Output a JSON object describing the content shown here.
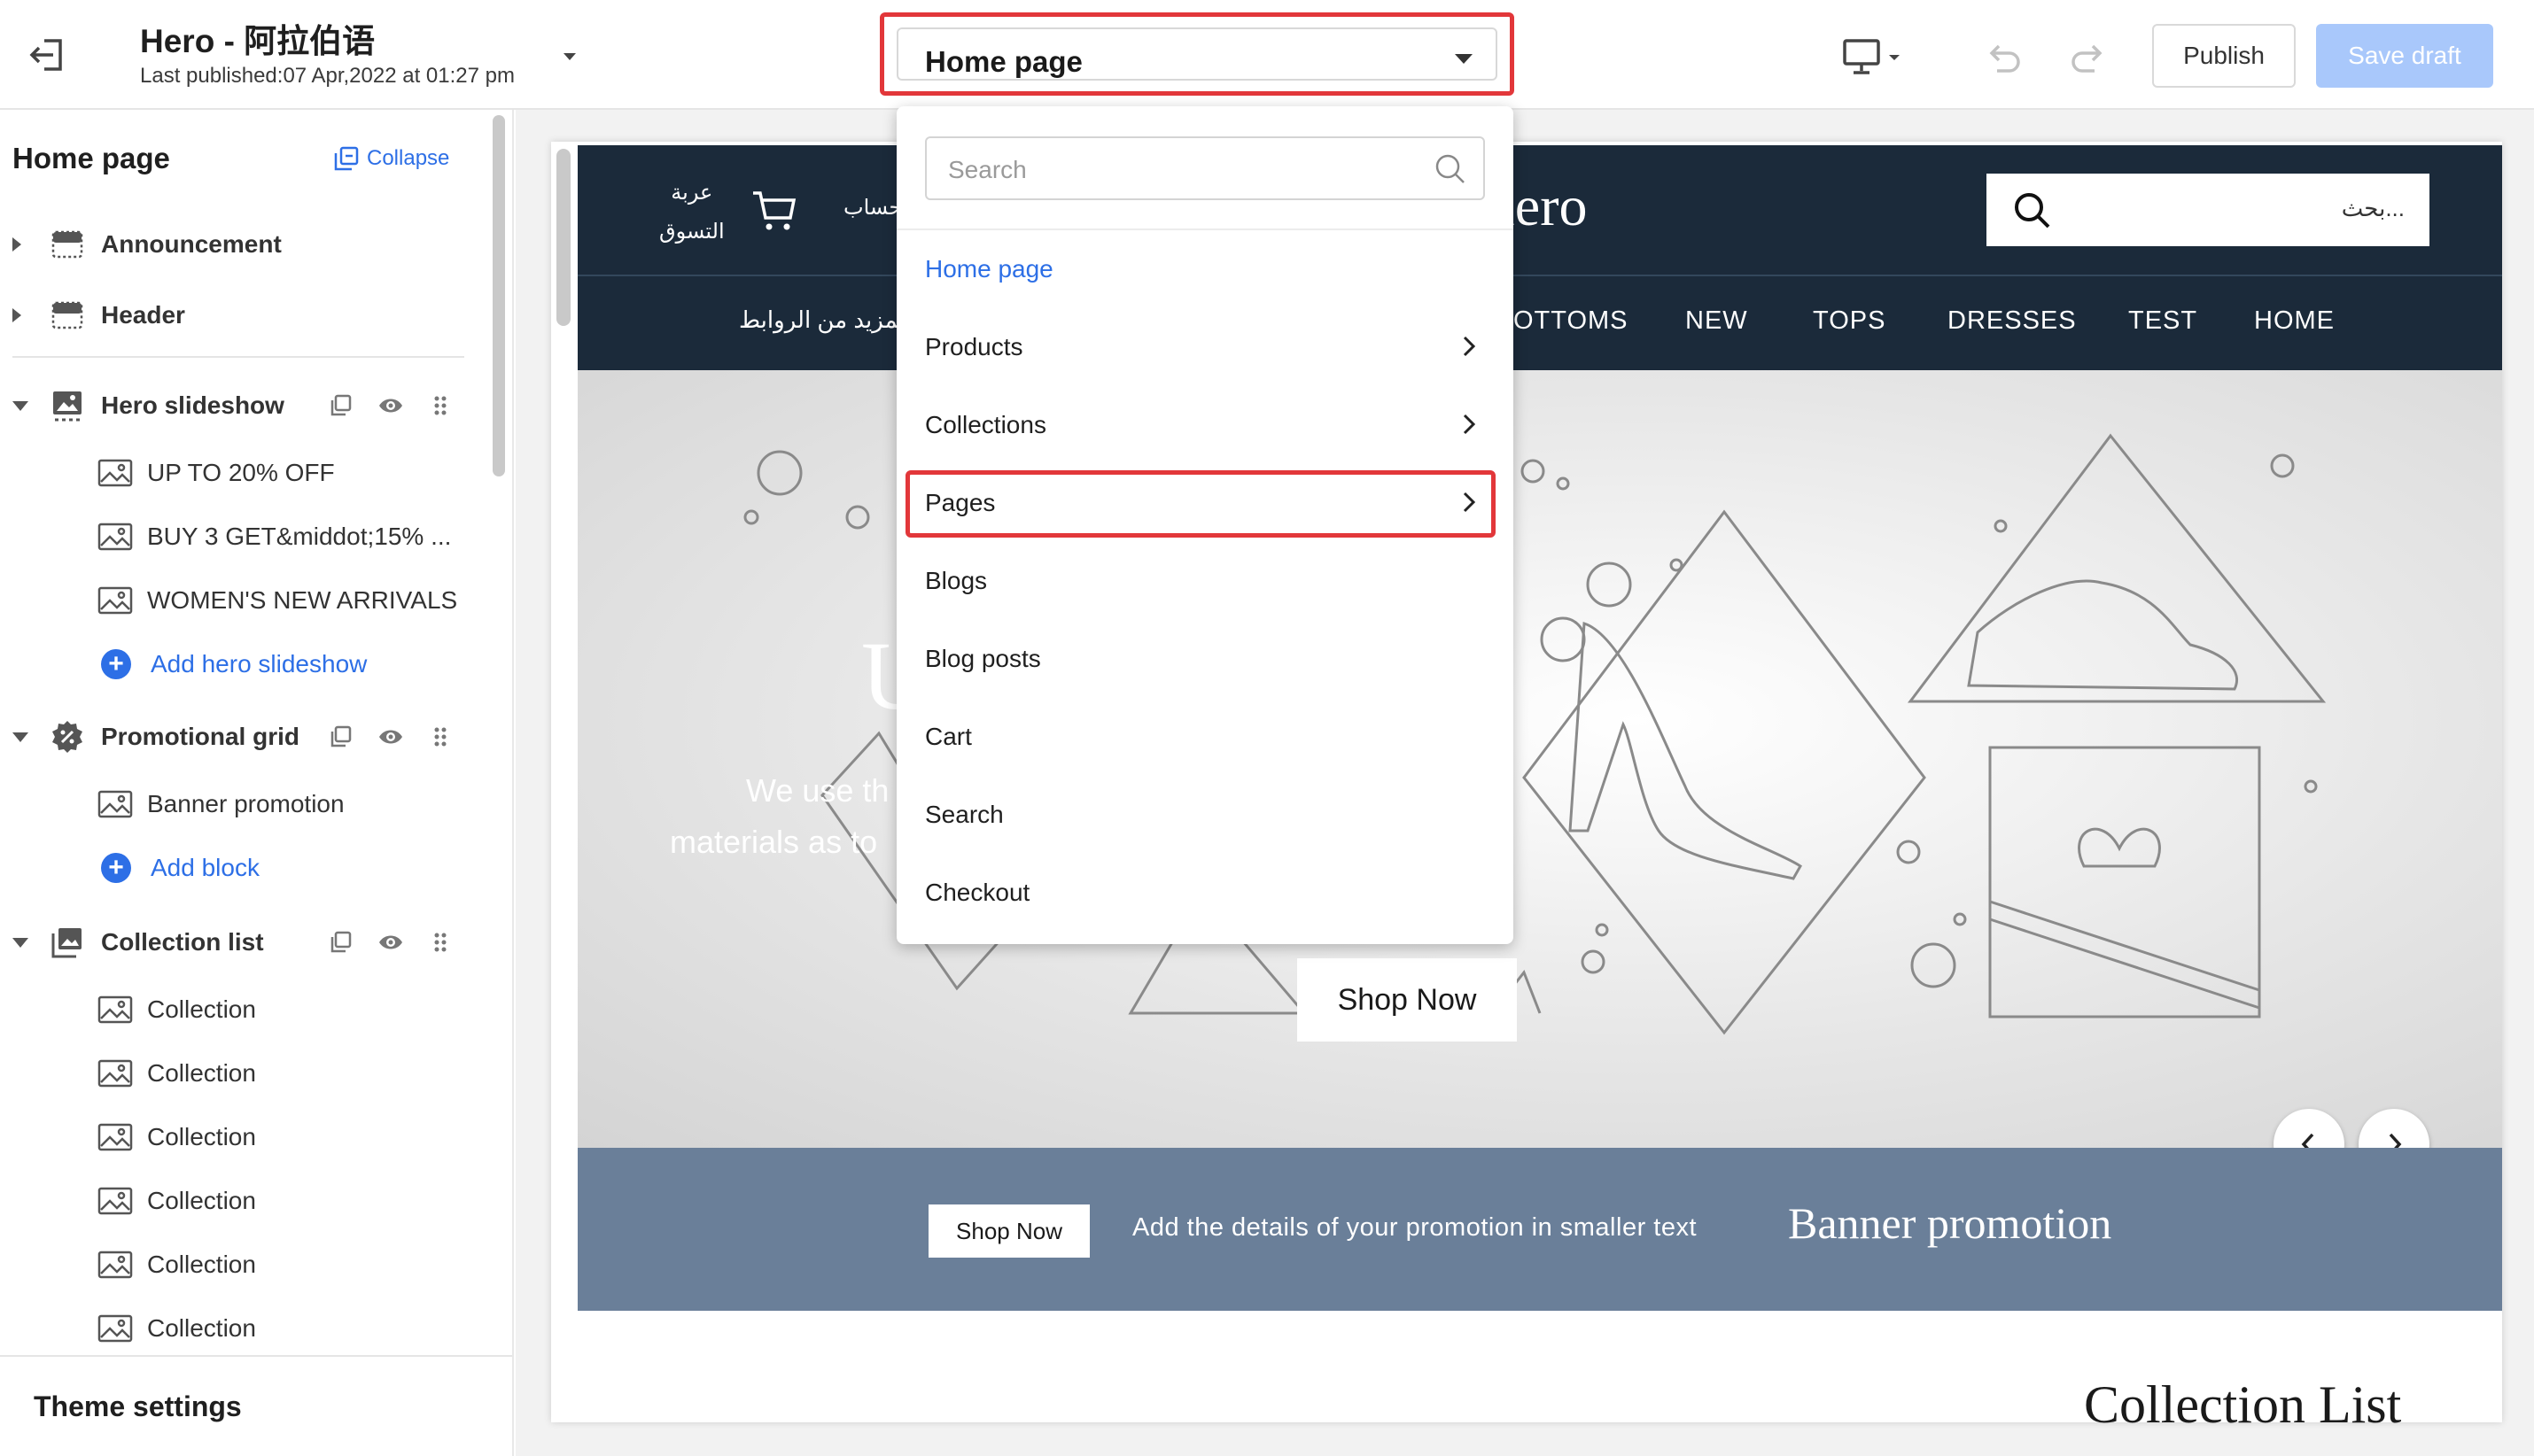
{
  "topbar": {
    "title": "Hero - 阿拉伯语",
    "last_published": "Last published:07 Apr,2022 at 01:27 pm",
    "page_selector": "Home page",
    "publish_label": "Publish",
    "save_draft_label": "Save draft"
  },
  "sidebar": {
    "heading": "Home page",
    "collapse_label": "Collapse",
    "sections": [
      {
        "label": "Announcement"
      },
      {
        "label": "Header"
      },
      {
        "label": "Hero slideshow",
        "children": [
          "UP TO 20% OFF",
          "BUY 3 GET&middot;15% ...",
          "WOMEN'S NEW ARRIVALS"
        ],
        "add_label": "Add hero slideshow"
      },
      {
        "label": "Promotional grid",
        "children": [
          "Banner promotion"
        ],
        "add_label": "Add block"
      },
      {
        "label": "Collection list",
        "children": [
          "Collection",
          "Collection",
          "Collection",
          "Collection",
          "Collection",
          "Collection"
        ]
      }
    ],
    "theme_settings": "Theme settings"
  },
  "dropdown": {
    "search_placeholder": "Search",
    "items": [
      {
        "label": "Home page",
        "active": true,
        "submenu": false
      },
      {
        "label": "Products",
        "submenu": true
      },
      {
        "label": "Collections",
        "submenu": true
      },
      {
        "label": "Pages",
        "submenu": true,
        "highlighted": true
      },
      {
        "label": "Blogs",
        "submenu": false
      },
      {
        "label": "Blog posts",
        "submenu": false
      },
      {
        "label": "Cart",
        "submenu": false
      },
      {
        "label": "Search",
        "submenu": false
      },
      {
        "label": "Checkout",
        "submenu": false
      }
    ]
  },
  "preview": {
    "search_placeholder": "بحث...",
    "logo_partial": "lero",
    "cart_label_line1": "عربة",
    "cart_label_line2": "التسوق",
    "account_partial": "حساب",
    "nav_more": "المزيد من الروابط",
    "nav_items": [
      "OTTOMS",
      "NEW",
      "TOPS",
      "DRESSES",
      "TEST",
      "HOME"
    ],
    "hero_heading_partial": "U",
    "hero_line1_partial": "We use th",
    "hero_line2_partial": "materials as to",
    "shop_now": "Shop Now",
    "promo_button": "Shop Now",
    "promo_text": "Add the details of your promotion in smaller text",
    "promo_title": "Banner promotion",
    "collection_list_title": "Collection List"
  },
  "colors": {
    "accent_blue": "#2d6fe6",
    "highlight_red": "#e2373a",
    "save_draft_disabled": "#a9c8fb",
    "store_header": "#1b2a3a",
    "promo_band": "#6a7f99"
  }
}
